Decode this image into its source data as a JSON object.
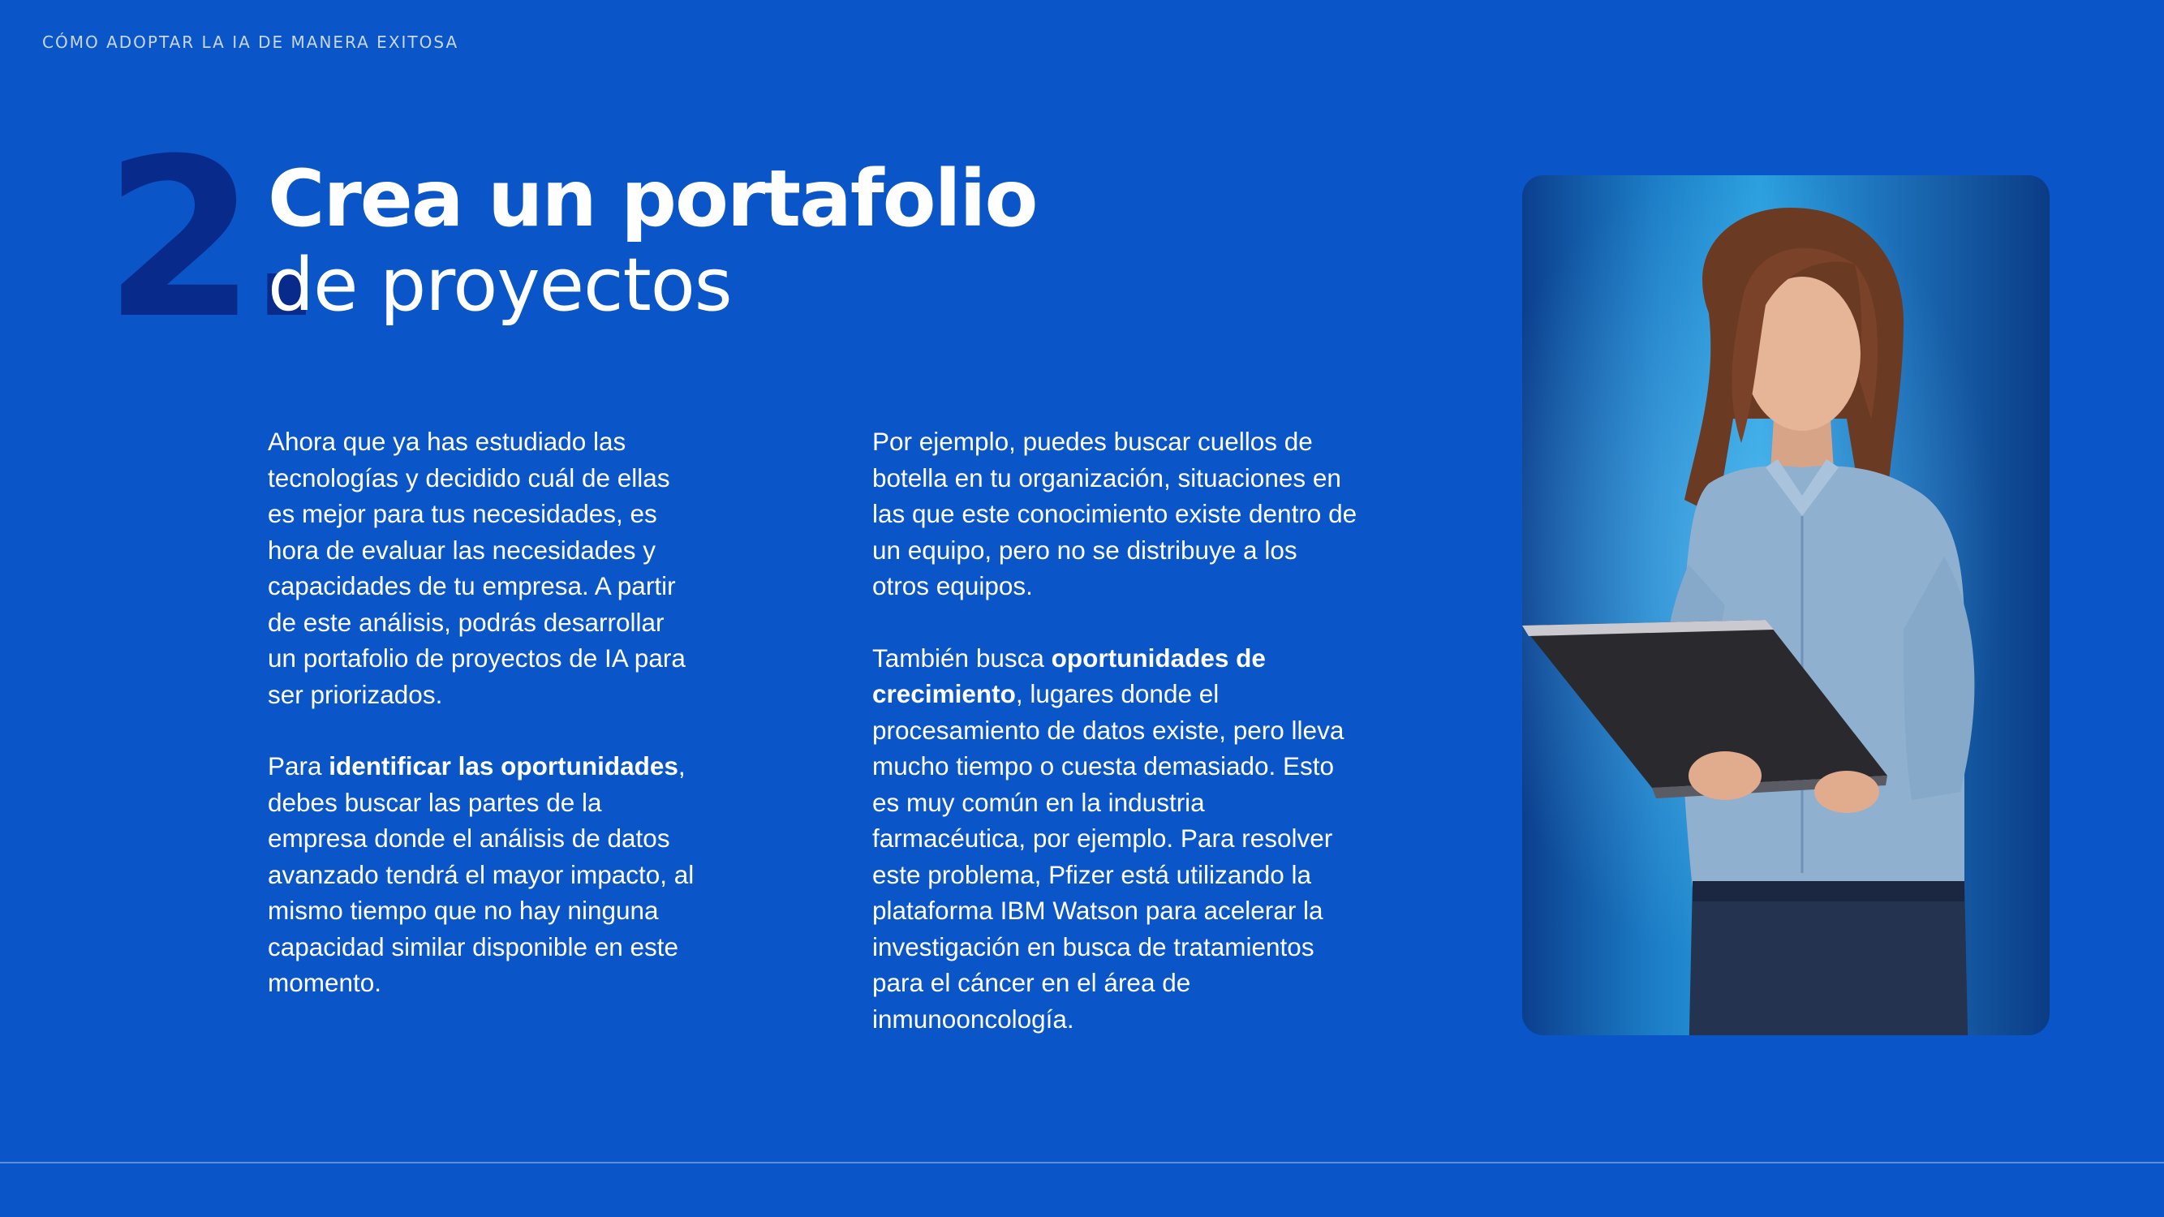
{
  "header": {
    "running_title": "CÓMO ADOPTAR LA IA DE MANERA EXITOSA"
  },
  "section": {
    "number": "2.",
    "title_line1": "Crea un portafolio",
    "title_line2": "de proyectos"
  },
  "left_column": {
    "p1": "Ahora que ya has estudiado las tecnologías y decidido cuál de ellas es mejor para tus necesidades, es hora de evaluar las necesidades y capacidades de tu empresa. A partir de este análisis, podrás desarrollar un portafolio de proyectos de IA para ser priorizados.",
    "p2_prefix": "Para ",
    "p2_bold": "identificar las oportunidades",
    "p2_rest": ", debes buscar las partes de la empresa donde el análisis de datos avanzado tendrá el mayor impacto, al mismo tiempo que no hay ninguna capacidad similar disponible en este momento."
  },
  "right_column": {
    "p1": "Por ejemplo, puedes buscar cuellos de botella en tu organización, situaciones en las que este conocimiento existe dentro de un equipo, pero no se distribuye a los otros equipos.",
    "p2_prefix": "También busca ",
    "p2_bold": "oportunidades de crecimiento",
    "p2_rest": ", lugares donde el procesamiento de datos existe, pero lleva mucho tiempo o cuesta demasiado. Esto es muy común en la industria farmacéutica, por ejemplo. Para resolver este problema, Pfizer está utilizando la plataforma IBM Watson para acelerar la investigación en busca de tratamientos para el cáncer en el área de inmunooncología."
  },
  "colors": {
    "background": "#0a55c8",
    "number": "#082a8a",
    "text": "#ffffff"
  }
}
